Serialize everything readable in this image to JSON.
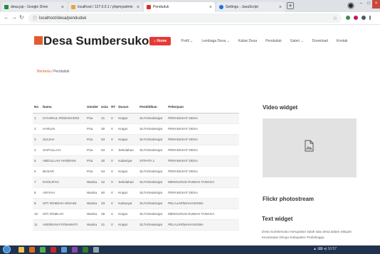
{
  "browser": {
    "tabs": [
      {
        "label": "desa.jsp - Google Drive",
        "color": "#1e8e3e",
        "active": false
      },
      {
        "label": "localhost / 127.0.0.1 / phpmyadmin",
        "color": "#e8a33d",
        "active": false
      },
      {
        "label": "Penduduk",
        "color": "#d93025",
        "active": true
      },
      {
        "label": "Settings - JavaScript",
        "color": "#1a73e8",
        "active": false
      }
    ],
    "url": "localhost/desa/penduduk"
  },
  "site": {
    "brand": "Desa Sumbersuko",
    "accent": "#e25b2c",
    "nav": {
      "home": "Home",
      "items": [
        "Profil ⌄",
        "Lembaga Desa ⌄",
        "Kabar Desa",
        "Penduduk",
        "Galeri ⌄",
        "Download",
        "Kontak"
      ]
    }
  },
  "breadcrumb": {
    "home": "Beranda",
    "separator": " / ",
    "current": "Penduduk"
  },
  "table": {
    "headers": [
      "No",
      "Nama",
      "Gender",
      "Usia",
      "RT",
      "Dusun",
      "Pendidikan",
      "Pekerjaan"
    ],
    "rows": [
      [
        "1",
        "SYAHRUL ROMADHONI",
        "Pria",
        "41",
        "0",
        "Krajan",
        "SLTA/Sederajat",
        "PERANGKAT DESA"
      ],
      [
        "2",
        "HARLIN",
        "Pria",
        "30",
        "0",
        "Krajan",
        "SLTA/Sederajat",
        "PERANGKAT DESA"
      ],
      [
        "3",
        "SULIHA",
        "Pria",
        "53",
        "0",
        "Krajan",
        "SLTA/Sederajat",
        "PERANGKAT DESA"
      ],
      [
        "4",
        "SAIFULLAH",
        "Pria",
        "53",
        "0",
        "Sekolahan",
        "SLTA/Sederajat",
        "PERANGKAT DESA"
      ],
      [
        "5",
        "ABDULLAH HAMDANI",
        "Pria",
        "30",
        "0",
        "Kabanyar",
        "STRATA 1",
        "PERANGKAT DESA"
      ],
      [
        "6",
        "BUSAR",
        "Pria",
        "54",
        "0",
        "Krajan",
        "SLTA/Sederajat",
        "PERANGKAT DESA"
      ],
      [
        "7",
        "KHOLIFAH",
        "Wanita",
        "42",
        "0",
        "Sekolahan",
        "SLTA/Sederajat",
        "MENGURUS RUMAH TANGGA"
      ],
      [
        "8",
        "ARIYAH",
        "Wanita",
        "50",
        "0",
        "Krajan",
        "SLTA/Sederajat",
        "PERANGKAT DESA"
      ],
      [
        "9",
        "SITI ROMZAH ISNAINI",
        "Wanita",
        "23",
        "0",
        "Kabanyar",
        "SLTA/Sederajat",
        "PELAJAR/MAHASISWA"
      ],
      [
        "10",
        "SITI ROMLAH",
        "Wanita",
        "28",
        "0",
        "Krajan",
        "SLTA/Sederajat",
        "MENGURUS RUMAH TANGGA"
      ],
      [
        "11",
        "ANDRIANI FATMAWATI",
        "Wanita",
        "21",
        "0",
        "Krajan",
        "SLTA/Sederajat",
        "PELAJAR/MAHASISWA"
      ]
    ]
  },
  "sidebar": {
    "video_title": "Video widget",
    "flickr_title": "Flickr photostream",
    "text_title": "Text widget",
    "text_body": "Desa Sumbersuko merupakan salah satu desa dalam wilayah Kecamatan Dringu Kabupaten Probolinggo."
  },
  "taskbar": {
    "clock": "10:57"
  }
}
